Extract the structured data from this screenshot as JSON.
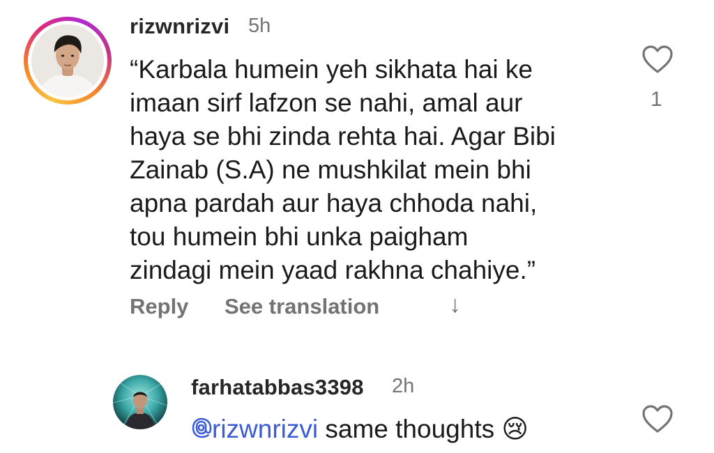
{
  "comments": [
    {
      "username": "rizwnrizvi",
      "time": "5h",
      "lines": [
        "“Karbala humein yeh sikhata hai ke",
        "imaan sirf lafzon se nahi, amal aur",
        "haya se bhi zinda rehta hai. Agar Bibi",
        "Zainab (S.A) ne mushkilat mein bhi",
        "apna pardah aur haya chhoda nahi,",
        "tou humein bhi unka paigham",
        "zindagi mein yaad rakhna chahiye.”"
      ],
      "like_count": "1",
      "actions": {
        "reply": "Reply",
        "see_translation": "See translation",
        "arrow": "↓"
      }
    },
    {
      "username": "farhatabbas3398",
      "time": "2h",
      "mention": "rizwnrizvi",
      "text": " same thoughts ",
      "emoji": "😢"
    }
  ],
  "icons": {
    "heart": "heart-outline-icon",
    "mention": "threads-at-icon"
  },
  "colors": {
    "username": "#262626",
    "secondary": "#737373",
    "mention": "#3b5bd6",
    "story_ring": [
      "#f9c440",
      "#f58529",
      "#dd2a7b",
      "#b12ad1"
    ]
  }
}
